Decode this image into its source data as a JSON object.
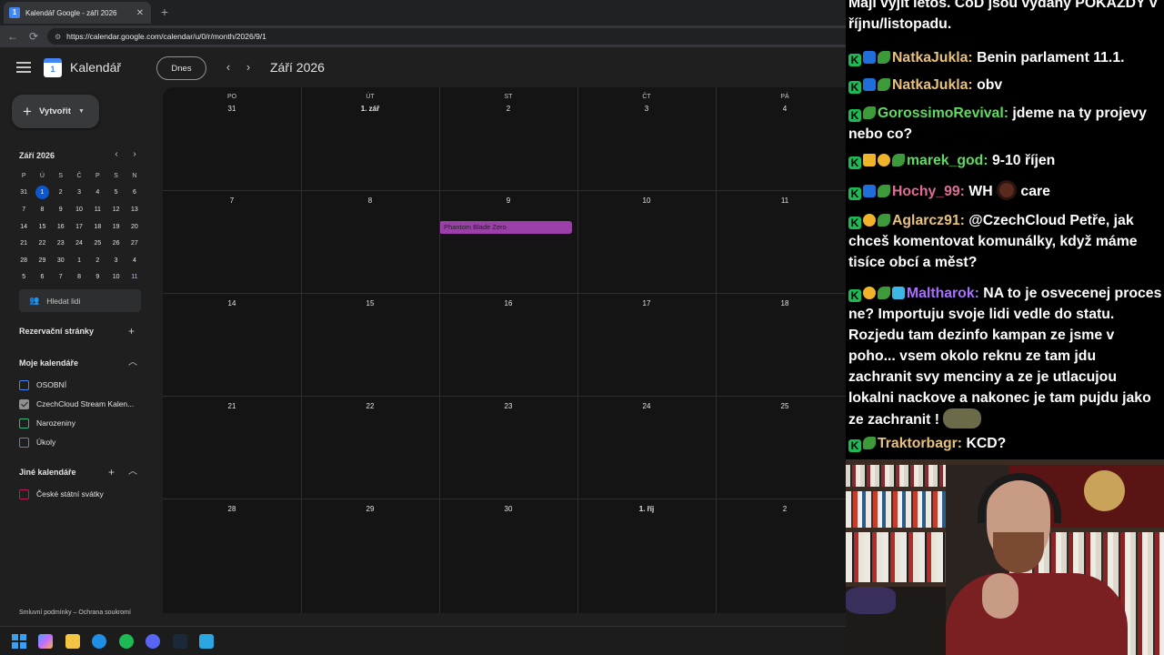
{
  "browser": {
    "tab_title": "Kalendář Google - září 2026",
    "tab_close": "✕",
    "new_tab": "+",
    "url": "https://calendar.google.com/calendar/u/0/r/month/2026/9/1",
    "back_icon": "←",
    "reload_icon": "⟳",
    "favicon_text": "1"
  },
  "calendar": {
    "app_title": "Kalendář",
    "logo_text": "1",
    "today_button": "Dnes",
    "prev_icon": "‹",
    "next_icon": "›",
    "month_title": "Září 2026",
    "create_button": "Vytvořit",
    "mini": {
      "title": "Září 2026",
      "prev": "‹",
      "next": "›",
      "days_of_week": [
        "P",
        "Ú",
        "S",
        "Č",
        "P",
        "S",
        "N"
      ],
      "weeks": [
        [
          "31",
          "1",
          "2",
          "3",
          "4",
          "5",
          "6"
        ],
        [
          "7",
          "8",
          "9",
          "10",
          "11",
          "12",
          "13"
        ],
        [
          "14",
          "15",
          "16",
          "17",
          "18",
          "19",
          "20"
        ],
        [
          "21",
          "22",
          "23",
          "24",
          "25",
          "26",
          "27"
        ],
        [
          "28",
          "29",
          "30",
          "1",
          "2",
          "3",
          "4"
        ],
        [
          "5",
          "6",
          "7",
          "8",
          "9",
          "10",
          "11"
        ]
      ]
    },
    "search_people": "Hledat lidi",
    "booking_pages": "Rezervační stránky",
    "my_calendars": {
      "title": "Moje kalendáře",
      "items": [
        {
          "label": "OSOBNÍ",
          "color": "#4285f4",
          "checked": false
        },
        {
          "label": "CzechCloud Stream Kalen...",
          "color": "#8e918f",
          "checked": true
        },
        {
          "label": "Narozeniny",
          "color": "#33b679",
          "checked": false
        },
        {
          "label": "Úkoly",
          "color": "#4285f4",
          "checked": false
        }
      ]
    },
    "other_calendars": {
      "title": "Jiné kalendáře",
      "items": [
        {
          "label": "České státní svátky",
          "color": "#c2185b",
          "checked": false
        }
      ]
    },
    "footer": "Smluvní podmínky – Ochrana soukromí",
    "grid": {
      "days_of_week": [
        "PO",
        "ÚT",
        "ST",
        "ČT",
        "PÁ"
      ],
      "weeks": [
        [
          "31",
          "1. zář",
          "2",
          "3",
          "4"
        ],
        [
          "7",
          "8",
          "9",
          "10",
          "11"
        ],
        [
          "14",
          "15",
          "16",
          "17",
          "18"
        ],
        [
          "21",
          "22",
          "23",
          "24",
          "25"
        ],
        [
          "28",
          "29",
          "30",
          "1. říj",
          "2"
        ]
      ],
      "event": {
        "title": "Phantom Blade Zero",
        "color": "#9b40a8"
      }
    }
  },
  "chat": {
    "messages": [
      {
        "user": "",
        "user_color": "#ffffff",
        "text": "Mají vyjít letos. CoD jsou vydaný POKAŽDÝ v říjnu/listopadu."
      },
      {
        "user": "NatkaJukla",
        "user_color": "#e8c27a",
        "text": "Benin parlament 11.1."
      },
      {
        "user": "NatkaJukla",
        "user_color": "#e8c27a",
        "text": "obv"
      },
      {
        "user": "GorossimoRevival",
        "user_color": "#5fdc5f",
        "text": "jdeme na ty projevy nebo co?"
      },
      {
        "user": "marek_god",
        "user_color": "#5fdc5f",
        "text": "9-10 říjen"
      },
      {
        "user": "Hochy_99",
        "user_color": "#e06c95",
        "text": "WH",
        "tail": "care"
      },
      {
        "user": "Aglarcz91",
        "user_color": "#e8c27a",
        "text": "@CzechCloud Petře, jak chceš komentovat komunálky, když máme tisíce obcí a měst?"
      },
      {
        "user": "Maltharok",
        "user_color": "#a970ff",
        "text": "NA to je osvecenej proces ne? Importuju svoje lidi vedle do statu. Rozjedu tam dezinfo kampan ze jsme v poho... vsem okolo reknu ze tam jdu zachranit svy menciny a ze je utlacujou lokalni nackove a nakonec je tam pujdu jako ze zachranit !"
      },
      {
        "user": "Traktorbagr",
        "user_color": "#e8c27a",
        "text": "KCD?"
      }
    ]
  }
}
